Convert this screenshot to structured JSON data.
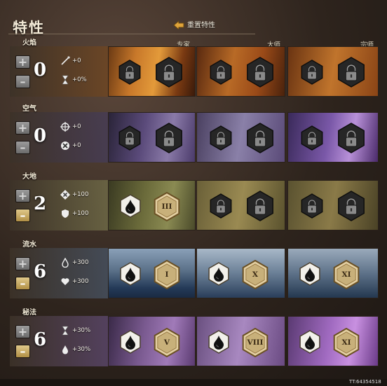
{
  "window": {
    "title": "特性"
  },
  "reset_button": {
    "label": "重置特性"
  },
  "columns": [
    "专家",
    "大师",
    "宗师"
  ],
  "lines": [
    {
      "name": "火焰",
      "points": "0",
      "minus_active": false,
      "stats": [
        {
          "icon": "staff-icon",
          "text": "+0"
        },
        {
          "icon": "hourglass-icon",
          "text": "+0%"
        }
      ],
      "slots": [
        [
          "locked",
          "locked"
        ],
        [
          "locked",
          "locked"
        ],
        [
          "locked",
          "locked"
        ]
      ]
    },
    {
      "name": "空气",
      "points": "0",
      "minus_active": false,
      "stats": [
        {
          "icon": "crosshair-icon",
          "text": "+0"
        },
        {
          "icon": "cross-circle-icon",
          "text": "+0"
        }
      ],
      "slots": [
        [
          "locked",
          "locked"
        ],
        [
          "locked",
          "locked"
        ],
        [
          "locked",
          "locked"
        ]
      ]
    },
    {
      "name": "大地",
      "points": "2",
      "minus_active": true,
      "stats": [
        {
          "icon": "cross-diamond-icon",
          "text": "+100"
        },
        {
          "icon": "shield-icon",
          "text": "+100"
        }
      ],
      "slots": [
        [
          "drop",
          "III"
        ],
        [
          "locked",
          "locked"
        ],
        [
          "locked",
          "locked"
        ]
      ]
    },
    {
      "name": "流水",
      "points": "6",
      "minus_active": true,
      "stats": [
        {
          "icon": "teardrop-icon",
          "text": "+300"
        },
        {
          "icon": "heart-icon",
          "text": "+300"
        }
      ],
      "slots": [
        [
          "drop",
          "I"
        ],
        [
          "drop",
          "X"
        ],
        [
          "drop",
          "XI"
        ]
      ]
    },
    {
      "name": "秘法",
      "points": "6",
      "minus_active": true,
      "stats": [
        {
          "icon": "hourglass-icon",
          "text": "+30%"
        },
        {
          "icon": "drop-icon",
          "text": "+30%"
        }
      ],
      "slots": [
        [
          "drop",
          "V"
        ],
        [
          "drop",
          "VIII"
        ],
        [
          "drop",
          "XI"
        ]
      ]
    }
  ],
  "footer": {
    "id": "TT:64354518"
  },
  "colors": {
    "locked_hex": "#262626",
    "unlocked_hex": "#f2f0ea",
    "trait_hex": "#e3cfa2"
  }
}
